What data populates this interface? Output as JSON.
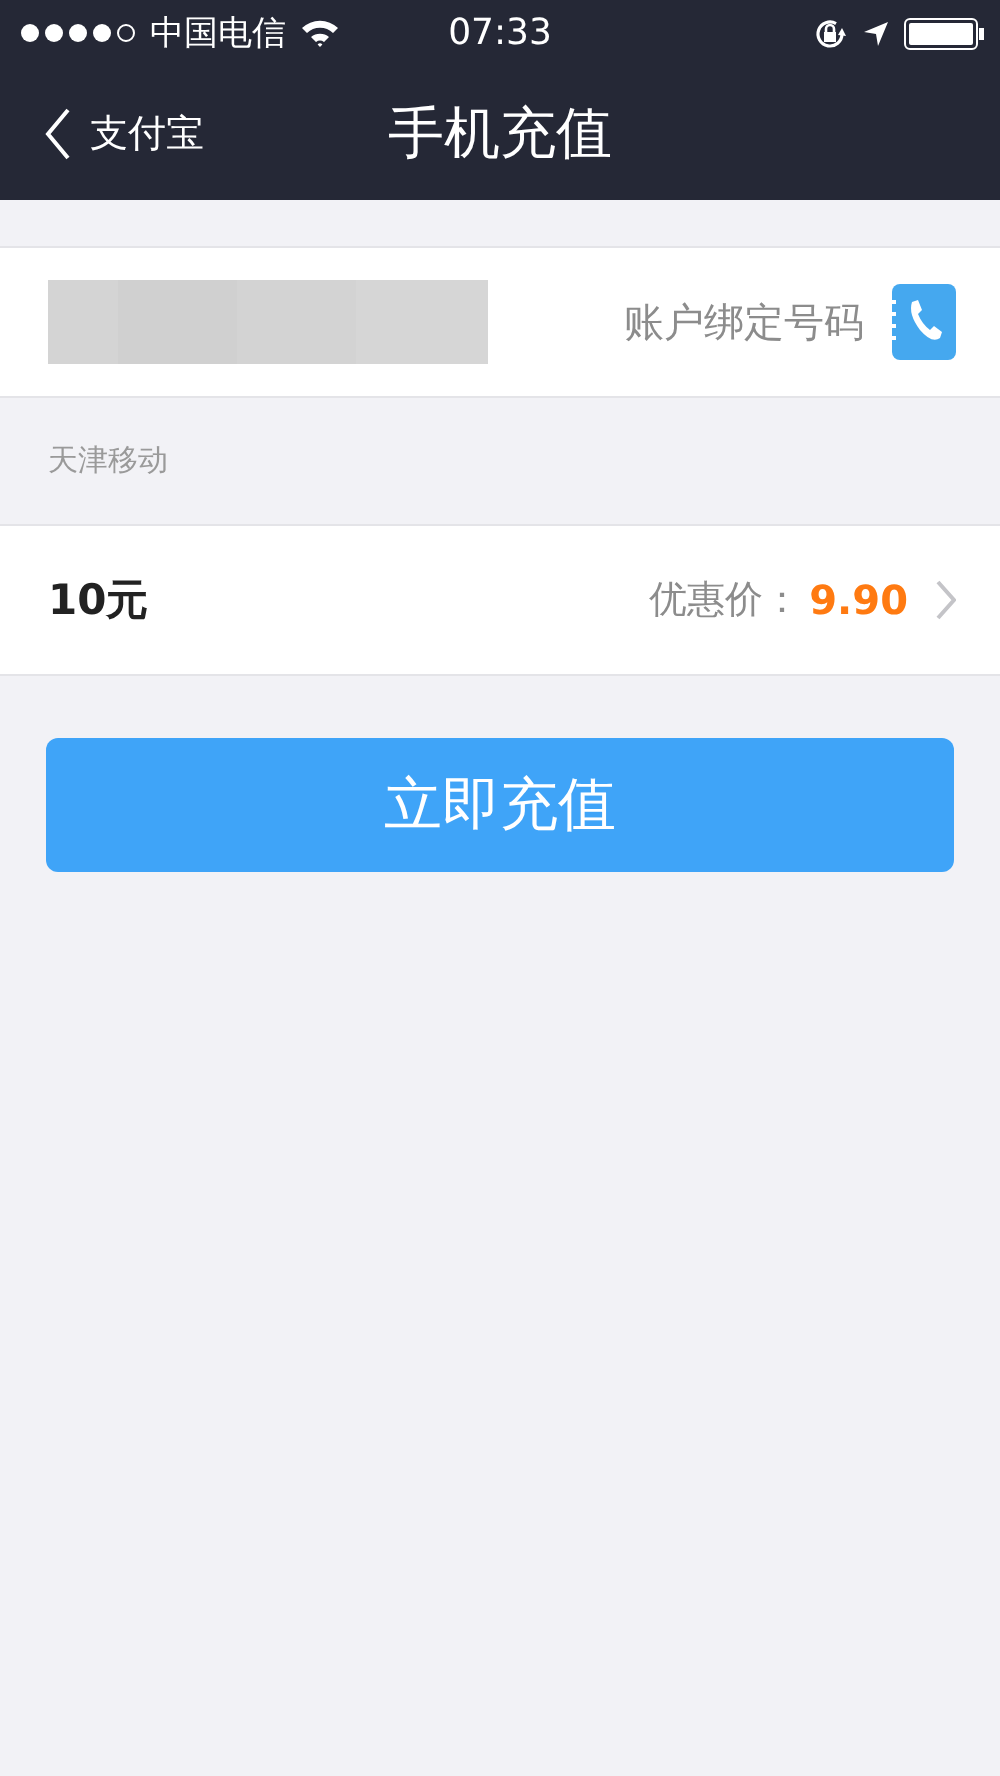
{
  "status_bar": {
    "carrier": "中国电信",
    "time": "07:33"
  },
  "nav": {
    "back_label": "支付宝",
    "title": "手机充值"
  },
  "phone_row": {
    "bound_label": "账户绑定号码"
  },
  "carrier_note": "天津移动",
  "amount_row": {
    "amount": "10元",
    "price_label": "优惠价：",
    "price": "9.90"
  },
  "button": "立即充值"
}
